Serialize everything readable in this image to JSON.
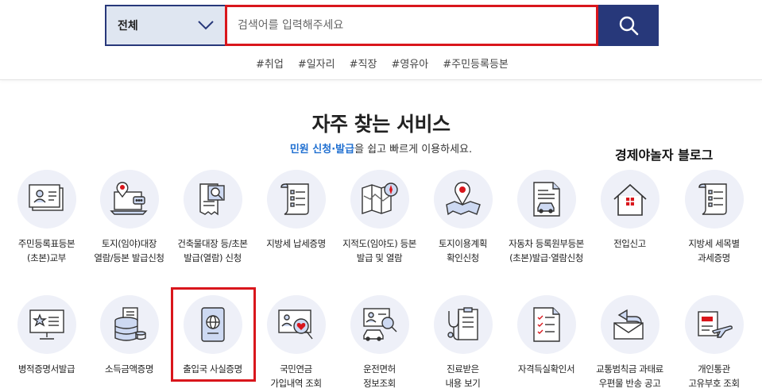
{
  "search": {
    "category": "전체",
    "placeholder": "검색어를 입력해주세요"
  },
  "hashtags": [
    "#취업",
    "#일자리",
    "#직장",
    "#영유아",
    "#주민등록등본"
  ],
  "section": {
    "title": "자주 찾는 서비스",
    "subtitle_highlight": "민원 신청·발급",
    "subtitle_rest": "을 쉽고 빠르게 이용하세요."
  },
  "watermark": "경제야놀자 블로그",
  "services_row1": [
    {
      "label": "주민등록표등본\n(초본)교부",
      "icon": "id-card-icon"
    },
    {
      "label": "토지(임야)대장\n열람/등본 발급신청",
      "icon": "laptop-map-pin-icon"
    },
    {
      "label": "건축물대장 등/초본\n발급(열람) 신청",
      "icon": "document-search-icon"
    },
    {
      "label": "지방세 납세증명",
      "icon": "tax-certificate-icon"
    },
    {
      "label": "지적도(임야도) 등본\n발급 및 열람",
      "icon": "folded-map-icon"
    },
    {
      "label": "토지이용계획\n확인신청",
      "icon": "map-pin-icon"
    },
    {
      "label": "자동차 등록원부등본\n(초본)발급·열람신청",
      "icon": "car-document-icon"
    },
    {
      "label": "전입신고",
      "icon": "house-icon"
    },
    {
      "label": "지방세 세목별\n과세증명",
      "icon": "scroll-document-icon"
    }
  ],
  "services_row2": [
    {
      "label": "병적증명서발급",
      "icon": "monitor-star-icon"
    },
    {
      "label": "소득금액증명",
      "icon": "database-document-icon"
    },
    {
      "label": "출입국 사실증명",
      "icon": "passport-icon"
    },
    {
      "label": "국민연금\n가입내역 조회",
      "icon": "monitor-heart-icon"
    },
    {
      "label": "운전면허\n정보조회",
      "icon": "car-search-icon"
    },
    {
      "label": "진료받은\n내용 보기",
      "icon": "stethoscope-icon"
    },
    {
      "label": "자격득실확인서",
      "icon": "checklist-icon"
    },
    {
      "label": "교통범칙금 과태료\n우편물 반송 공고",
      "icon": "mail-return-icon"
    },
    {
      "label": "개인통관\n고유부호 조회",
      "icon": "airplane-tag-icon"
    }
  ],
  "colors": {
    "navy": "#27387a",
    "highlight_red": "#d9161c",
    "link_blue": "#1f6fd1",
    "circle_bg": "#eef0f8"
  }
}
